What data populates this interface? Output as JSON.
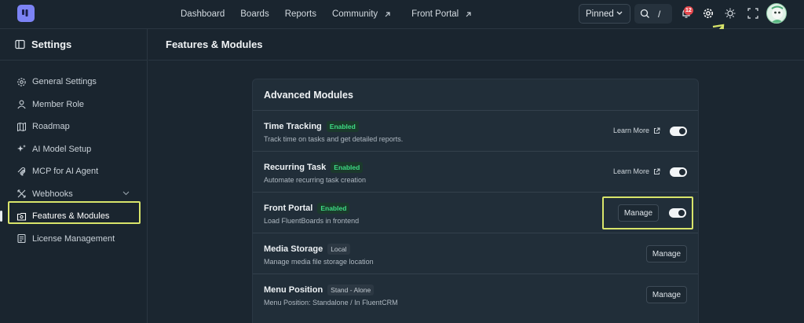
{
  "topbar": {
    "nav": [
      {
        "label": "Dashboard",
        "external": false
      },
      {
        "label": "Boards",
        "external": false
      },
      {
        "label": "Reports",
        "external": false
      },
      {
        "label": "Community",
        "external": true
      },
      {
        "label": "Front Portal",
        "external": true
      }
    ],
    "pinned_label": "Pinned",
    "search_shortcut": "/",
    "notification_count": "12"
  },
  "sidebar": {
    "title": "Settings",
    "items": [
      {
        "label": "General Settings",
        "icon": "gear-icon"
      },
      {
        "label": "Member Role",
        "icon": "user-icon"
      },
      {
        "label": "Roadmap",
        "icon": "map-icon"
      },
      {
        "label": "AI Model Setup",
        "icon": "sparkle-icon"
      },
      {
        "label": "MCP for AI Agent",
        "icon": "mcp-icon"
      },
      {
        "label": "Webhooks",
        "icon": "webhook-icon"
      },
      {
        "label": "Features & Modules",
        "icon": "modules-icon"
      },
      {
        "label": "License Management",
        "icon": "license-icon"
      }
    ]
  },
  "main": {
    "title": "Features & Modules",
    "card_title": "Advanced Modules",
    "modules": [
      {
        "name": "Time Tracking",
        "badge": "Enabled",
        "desc": "Track time on tasks and get detailed reports.",
        "learn": "Learn More"
      },
      {
        "name": "Recurring Task",
        "badge": "Enabled",
        "desc": "Automate recurring task creation",
        "learn": "Learn More"
      },
      {
        "name": "Front Portal",
        "badge": "Enabled",
        "desc": "Load FluentBoards in frontend",
        "button": "Manage"
      },
      {
        "name": "Media Storage",
        "badge": "Local",
        "desc": "Manage media file storage location",
        "button": "Manage"
      },
      {
        "name": "Menu Position",
        "badge": "Stand - Alone",
        "desc": "Menu Position: Standalone / In FluentCRM",
        "button": "Manage"
      }
    ]
  },
  "colors": {
    "accent_highlight": "#d8e46a",
    "enabled_green": "#3ddc84",
    "logo": "#7c83f5"
  }
}
